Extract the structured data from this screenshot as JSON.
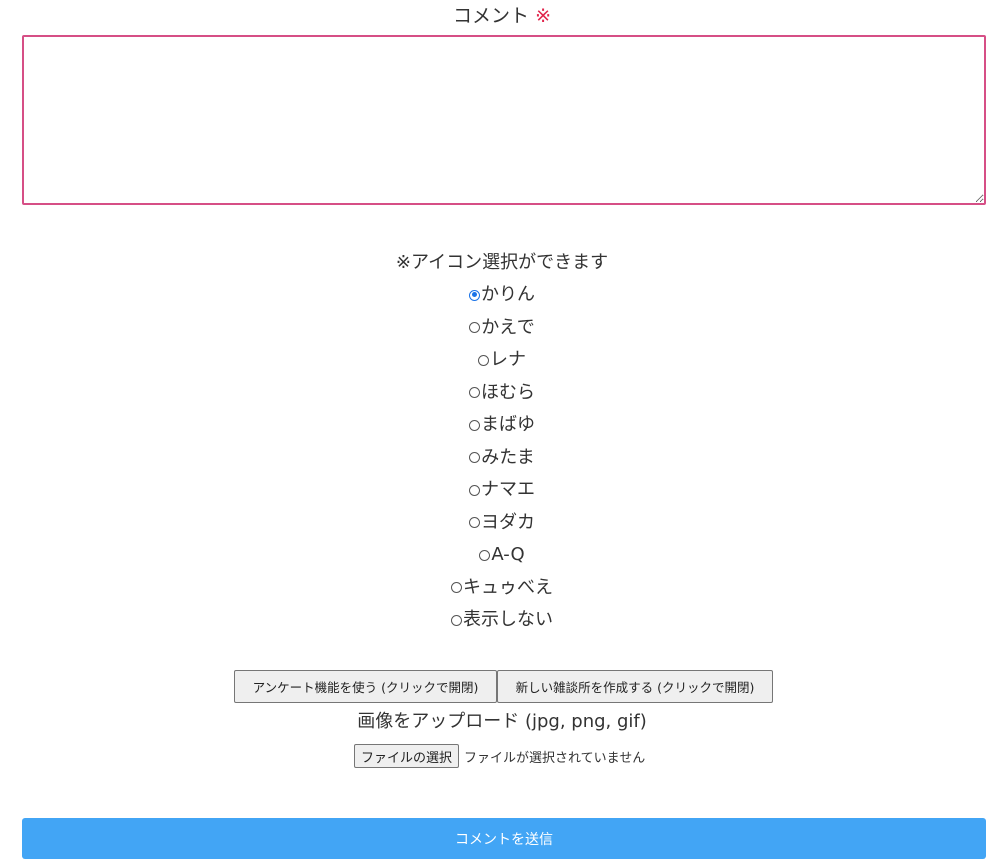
{
  "comment": {
    "label": "コメント",
    "required_mark": "※",
    "value": "",
    "border_color": "#d64f86"
  },
  "icon_select": {
    "note": "※アイコン選択ができます",
    "selected": "かりん",
    "options": [
      {
        "label": "かりん",
        "checked": true
      },
      {
        "label": "かえで",
        "checked": false
      },
      {
        "label": "レナ",
        "checked": false
      },
      {
        "label": "ほむら",
        "checked": false
      },
      {
        "label": "まばゆ",
        "checked": false
      },
      {
        "label": "みたま",
        "checked": false
      },
      {
        "label": "ナマエ",
        "checked": false
      },
      {
        "label": "ヨダカ",
        "checked": false
      },
      {
        "label": "A-Q",
        "checked": false
      },
      {
        "label": "キュゥべえ",
        "checked": false
      },
      {
        "label": "表示しない",
        "checked": false
      }
    ]
  },
  "toggles": {
    "survey_label": "アンケート機能を使う (クリックで開閉)",
    "new_thread_label": "新しい雑談所を作成する (クリックで開閉)"
  },
  "upload": {
    "label": "画像をアップロード (jpg, png, gif)",
    "choose_label": "ファイルの選択",
    "status": "ファイルが選択されていません"
  },
  "submit": {
    "label": "コメントを送信",
    "color": "#42a5f5"
  },
  "colors": {
    "required": "#e0244b",
    "radio_checked": "#1a73e8"
  }
}
